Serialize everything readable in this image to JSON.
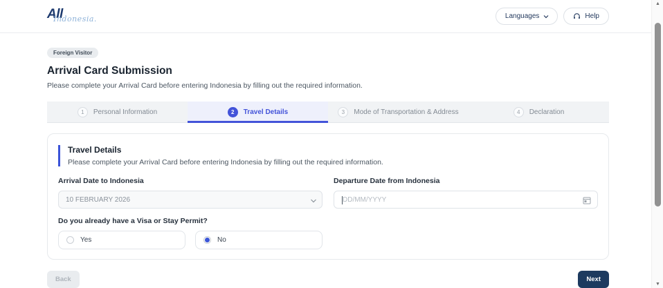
{
  "header": {
    "logo": {
      "primary": "All",
      "secondary": "Indonesia."
    },
    "languages_label": "Languages",
    "help_label": "Help"
  },
  "page": {
    "badge": "Foreign Visitor",
    "title": "Arrival Card Submission",
    "subtitle": "Please complete your Arrival Card before entering Indonesia by filling out the required information."
  },
  "steps": [
    {
      "number": "1",
      "label": "Personal Information",
      "state": "inactive"
    },
    {
      "number": "2",
      "label": "Travel Details",
      "state": "active"
    },
    {
      "number": "3",
      "label": "Mode of Transportation & Address",
      "state": "inactive"
    },
    {
      "number": "4",
      "label": "Declaration",
      "state": "inactive"
    }
  ],
  "card": {
    "title": "Travel Details",
    "subtitle": "Please complete your Arrival Card before entering Indonesia by filling out the required information.",
    "arrival": {
      "label": "Arrival Date to Indonesia",
      "value": "10 FEBRUARY 2026"
    },
    "departure": {
      "label": "Departure Date from Indonesia",
      "value": "",
      "placeholder": "DD/MM/YYYY"
    },
    "visa": {
      "label": "Do you already have a Visa or Stay Permit?",
      "options": [
        {
          "label": "Yes",
          "selected": false
        },
        {
          "label": "No",
          "selected": true
        }
      ]
    }
  },
  "footer": {
    "back_label": "Back",
    "next_label": "Next"
  },
  "scrollbar": {
    "up_glyph": "▲",
    "down_glyph": "▼"
  },
  "colors": {
    "accent": "#4353d9",
    "navy": "#1d3a5f",
    "radio_dot": "#3b56d8",
    "tab_active_bg": "#eef0fc"
  }
}
